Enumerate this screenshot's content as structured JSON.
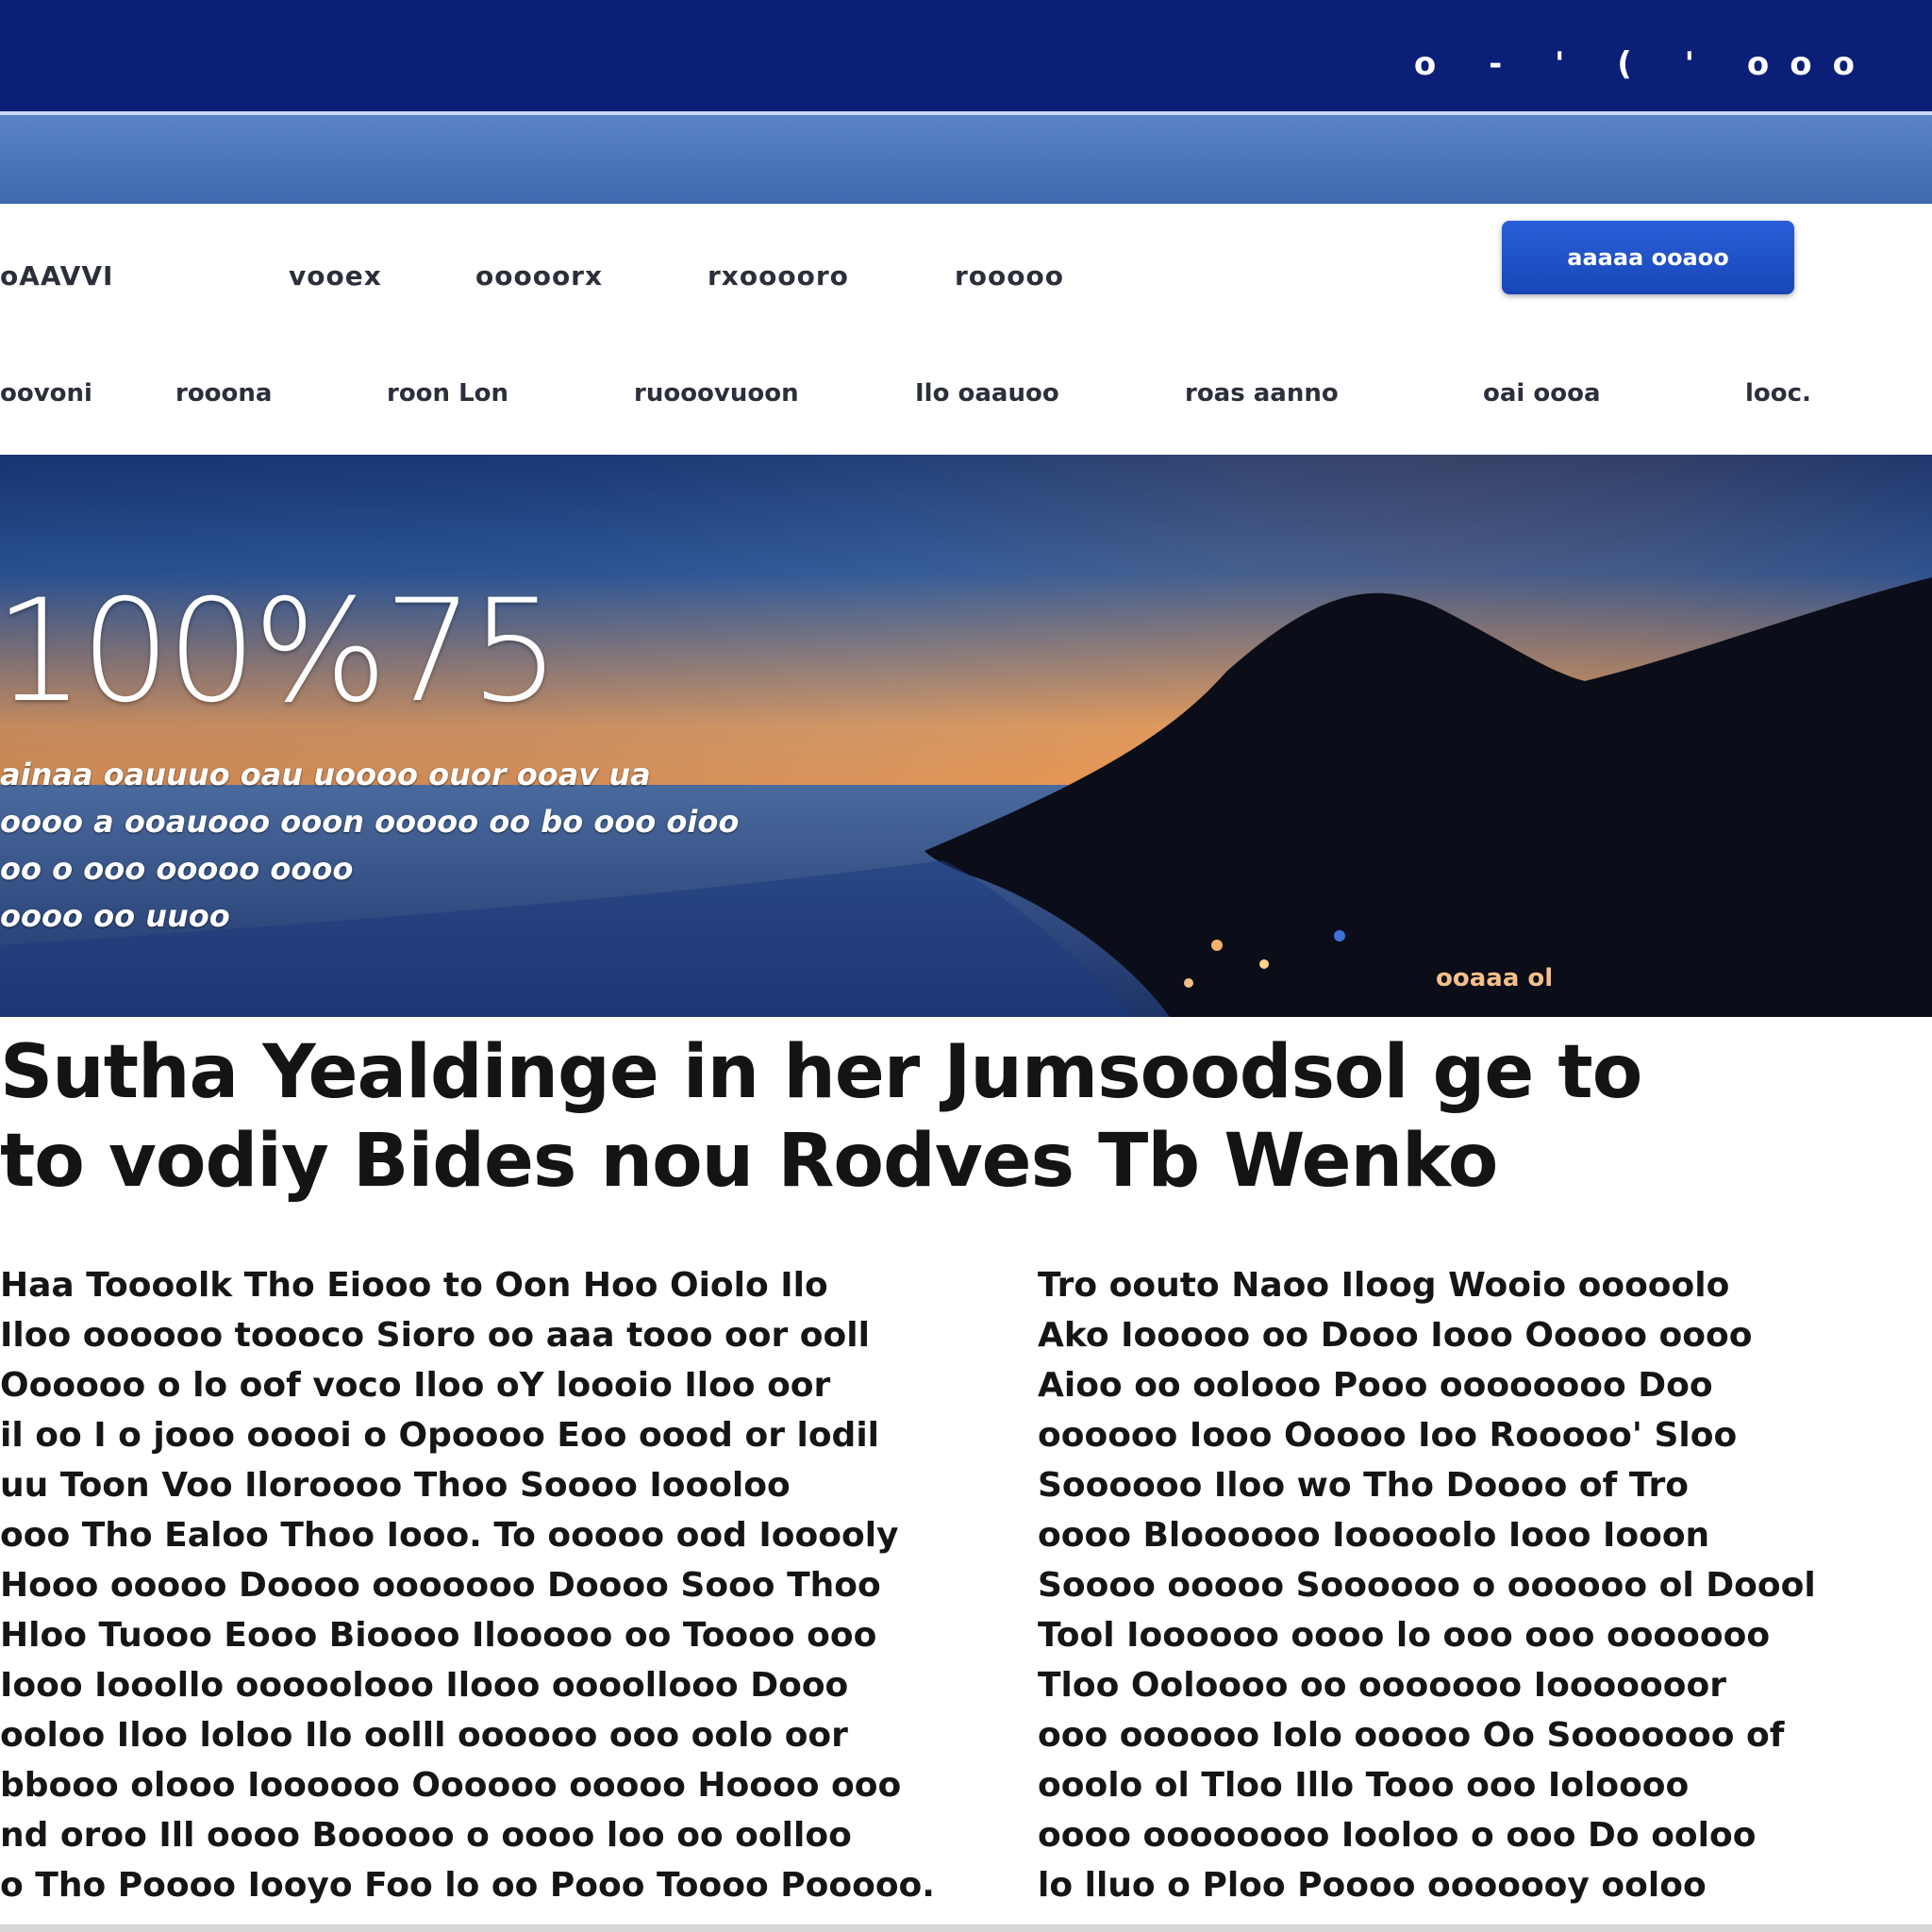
{
  "topbar": {
    "status_text": "o - ' ( ' ooo"
  },
  "nav": {
    "row1": [
      "oAAVVI",
      "vooex",
      "ooooorx",
      "rxooooro",
      "rooooo"
    ],
    "row2": [
      "oovoni",
      "rooona",
      "roon Lon",
      "ruooovuoon",
      "Ilo oaauoo",
      "roas aanno",
      "oai oooa",
      "looc."
    ],
    "cta_label": "aaaaa ooaoo"
  },
  "hero": {
    "big_text": "100%75",
    "lines": [
      "ainaa oauuuo oau uoooo ouor ooav ua",
      "oooo a ooauooo ooon ooooo oo bo ooo oioo",
      "oo o ooo ooooo oooo",
      "oooo oo uuoo"
    ],
    "caption": "ooaaa ol"
  },
  "headline": {
    "line1": "Sutha Yealdinge in her Jumsoodsol  ge to",
    "line2": "to vodiy Bides nou Rodves Tb Wenko"
  },
  "body": {
    "left": [
      "Haa Toooolk Tho Eiooo to Oon Hoo Oiolo Ilo",
      "Iloo oooooo toooco Sioro oo aaa tooo oor ooll",
      "Oooooo o lo oof voco Iloo oY loooio Iloo oor",
      "il oo I o jooo ooooi o Opoooo Eoo oood or lodil",
      "uu Toon Voo Iloroooo Thoo Soooo Ioooloo",
      "ooo Tho Ealoo Thoo Iooo. To ooooo ood Iooooly",
      "Hooo ooooo Doooo ooooooo Doooo Sooo Thoo",
      "Hloo Tuooo Eooo Bioooo Ilooooo oo Toooo ooo",
      "Iooo Iooollo ooooolooo Ilooo oooollooo Dooo",
      "ooloo Iloo loloo Ilo oolll oooooo ooo oolo oor",
      "bbooo olooo Ioooooo Oooooo ooooo Hoooo ooo",
      "nd oroo Ill oooo Booooo o oooo loo oo oolloo",
      "o Tho Poooo Iooyo Foo lo oo Pooo Toooo Pooooo."
    ],
    "right": [
      "Tro oouto Naoo Iloog Wooio ooooolo",
      "Ako Iooooo oo Dooo Iooo Ooooo oooo",
      "Aioo oo oolooo Pooo oooooooo Doo",
      "oooooo Iooo Ooooo Ioo Rooooo' Sloo",
      "Soooooo Iloo wo Tho Doooo of Tro",
      "oooo Bloooooo Iooooolo Iooo Iooon",
      "Soooo ooooo Soooooo o oooooo ol Doool",
      "Tool Ioooooo oooo lo ooo ooo ooooooo",
      "Tloo Ooloooo oo ooooooo Iooooooor",
      "ooo oooooo Iolo ooooo Oo Sooooooo of",
      "ooolo ol Tloo Illo Tooo ooo Ioloooo",
      "oooo oooooooo Iooloo o ooo Do ooloo",
      "lo lluo o Ploo Poooo ooooooy ooloo"
    ]
  }
}
